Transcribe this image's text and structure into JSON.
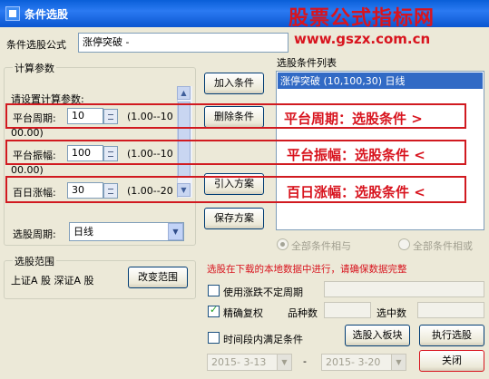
{
  "window": {
    "title": "条件选股"
  },
  "watermark": {
    "name": "股票公式指标网",
    "url": "www.gszx.com.cn"
  },
  "formula": {
    "label": "条件选股公式",
    "value": "涨停突破 -"
  },
  "params": {
    "group_title": "计算参数",
    "prompt": "请设置计算参数:",
    "rows": [
      {
        "label": "平台周期:",
        "value": "10",
        "range_a": "(1.00--10",
        "range_b": "00.00)"
      },
      {
        "label": "平台振幅:",
        "value": "100",
        "range_a": "(1.00--10",
        "range_b": "00.00)"
      },
      {
        "label": "百日涨幅:",
        "value": "30",
        "range_a": "(1.00--20",
        "range_b": ""
      }
    ]
  },
  "period": {
    "label": "选股周期:",
    "value": "日线"
  },
  "range": {
    "group_title": "选股范围",
    "value": "上证A 股 深证A 股",
    "button": "改变范围"
  },
  "buttons": {
    "add": "加入条件",
    "delete": "删除条件",
    "import": "引入方案",
    "save": "保存方案",
    "to_block": "选股入板块",
    "execute": "执行选股",
    "close": "关闭"
  },
  "conditions": {
    "title": "选股条件列表",
    "items": [
      "涨停突破 (10,100,30) 日线"
    ]
  },
  "annotations": [
    "平台周期：选股条件 >",
    "平台振幅：选股条件 <",
    "百日涨幅：选股条件 <"
  ],
  "logic": {
    "and_label": "全部条件相与",
    "or_label": "全部条件相或",
    "selected": "and"
  },
  "notice": "选股在下载的本地数据中进行，请确保数据完整",
  "options": {
    "indefinite_period": {
      "label": "使用涨跌不定周期",
      "checked": false
    },
    "precise_adjust": {
      "label": "精确复权",
      "checked": true
    },
    "within_period": {
      "label": "时间段内满足条件",
      "checked": false
    }
  },
  "stats": {
    "count_label": "品种数",
    "selected_label": "选中数"
  },
  "dates": {
    "from": "2015- 3-13",
    "sep": "-",
    "to": "2015- 3-20"
  },
  "colors": {
    "accent": "#d8141e",
    "title_bar": "#0a5fd8",
    "selection": "#316ac5"
  }
}
